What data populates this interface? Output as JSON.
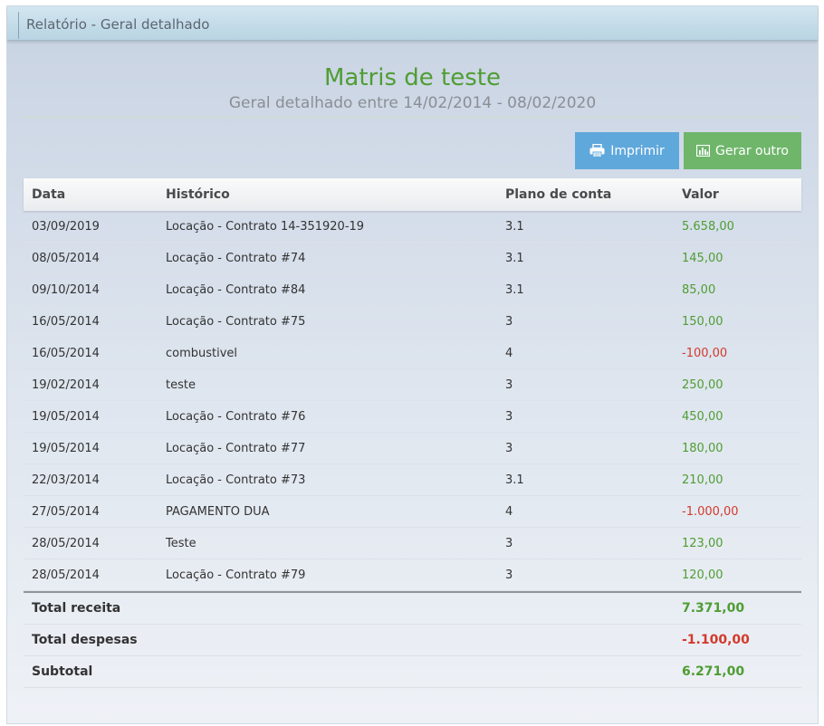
{
  "window": {
    "title": "Relatório - Geral detalhado"
  },
  "report": {
    "company": "Matris de teste",
    "subtitle": "Geral detalhado entre 14/02/2014 - 08/02/2020"
  },
  "actions": {
    "print_label": "Imprimir",
    "print_icon": "printer-icon",
    "generate_label": "Gerar outro",
    "generate_icon": "bar-chart-icon",
    "print_color": "#5fa8dc",
    "generate_color": "#6fb66b"
  },
  "table": {
    "headers": [
      "Data",
      "Histórico",
      "Plano de conta",
      "Valor"
    ],
    "rows": [
      {
        "data": "03/09/2019",
        "historico": "Locação - Contrato 14-351920-19",
        "plano": "3.1",
        "valor": "5.658,00",
        "type": "pos"
      },
      {
        "data": "08/05/2014",
        "historico": "Locação - Contrato #74",
        "plano": "3.1",
        "valor": "145,00",
        "type": "pos"
      },
      {
        "data": "09/10/2014",
        "historico": "Locação - Contrato #84",
        "plano": "3.1",
        "valor": "85,00",
        "type": "pos"
      },
      {
        "data": "16/05/2014",
        "historico": "Locação - Contrato #75",
        "plano": "3",
        "valor": "150,00",
        "type": "pos"
      },
      {
        "data": "16/05/2014",
        "historico": "combustivel",
        "plano": "4",
        "valor": "-100,00",
        "type": "neg"
      },
      {
        "data": "19/02/2014",
        "historico": "teste",
        "plano": "3",
        "valor": "250,00",
        "type": "pos"
      },
      {
        "data": "19/05/2014",
        "historico": "Locação - Contrato #76",
        "plano": "3",
        "valor": "450,00",
        "type": "pos"
      },
      {
        "data": "19/05/2014",
        "historico": "Locação - Contrato #77",
        "plano": "3",
        "valor": "180,00",
        "type": "pos"
      },
      {
        "data": "22/03/2014",
        "historico": "Locação - Contrato #73",
        "plano": "3.1",
        "valor": "210,00",
        "type": "pos"
      },
      {
        "data": "27/05/2014",
        "historico": "PAGAMENTO DUA",
        "plano": "4",
        "valor": "-1.000,00",
        "type": "neg"
      },
      {
        "data": "28/05/2014",
        "historico": "Teste",
        "plano": "3",
        "valor": "123,00",
        "type": "pos"
      },
      {
        "data": "28/05/2014",
        "historico": "Locação - Contrato #79",
        "plano": "3",
        "valor": "120,00",
        "type": "pos"
      }
    ],
    "totals": [
      {
        "label": "Total receita",
        "valor": "7.371,00",
        "type": "pos"
      },
      {
        "label": "Total despesas",
        "valor": "-1.100,00",
        "type": "neg"
      },
      {
        "label": "Subtotal",
        "valor": "6.271,00",
        "type": "pos"
      }
    ]
  },
  "colors": {
    "positive": "#4f9d33",
    "negative": "#d33a2c",
    "heading": "#4f9d33"
  }
}
